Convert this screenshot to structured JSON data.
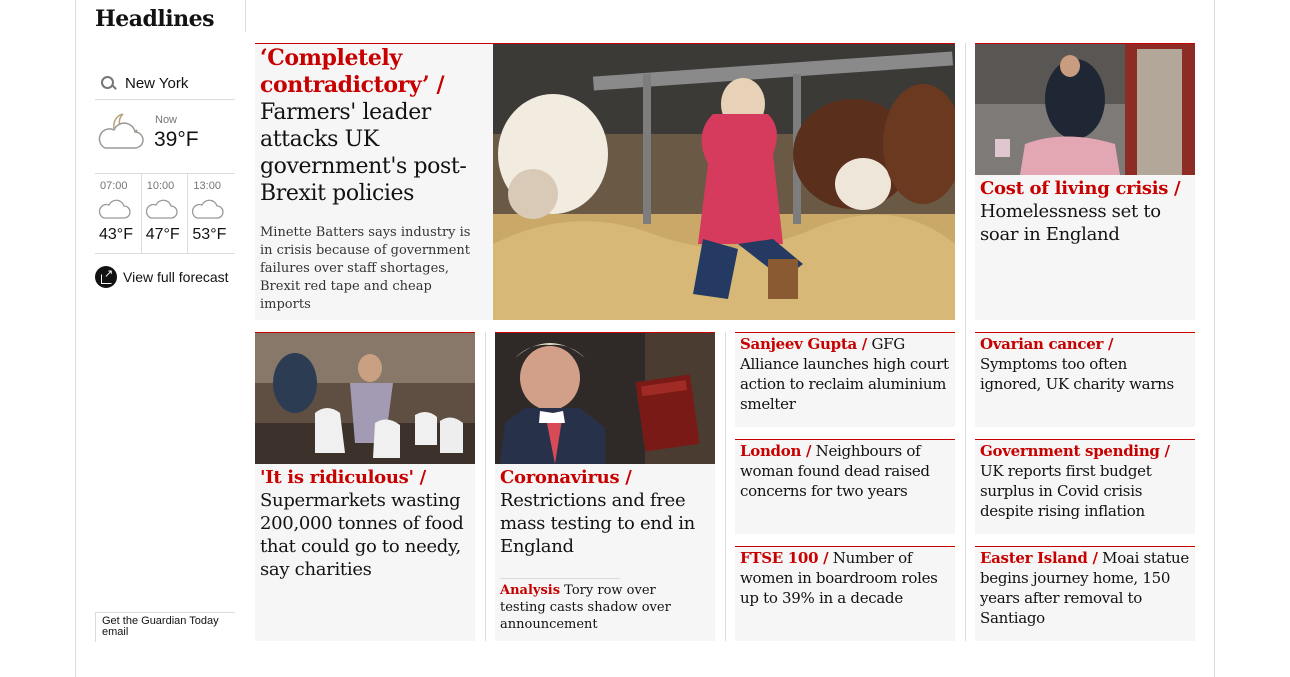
{
  "section": {
    "title": "Headlines"
  },
  "weather": {
    "location": "New York",
    "now_label": "Now",
    "now_temp": "39°F",
    "now_icon": "cloud-moon-icon",
    "forecast": [
      {
        "time": "07:00",
        "temp": "43°F",
        "icon": "cloud-icon"
      },
      {
        "time": "10:00",
        "temp": "47°F",
        "icon": "cloud-icon"
      },
      {
        "time": "13:00",
        "temp": "53°F",
        "icon": "cloud-icon"
      }
    ],
    "view_forecast": "View full forecast"
  },
  "signup": {
    "text": "Get the Guardian Today email"
  },
  "colors": {
    "kicker": "#c70000",
    "card_bg": "#f6f6f6",
    "rule": "#dcdcdc"
  },
  "stories": {
    "lead": {
      "kicker": "‘Completely contradictory’ /",
      "headline": "Farmers' leader attacks UK government's post-Brexit policies",
      "standfirst": "Minette Batters says industry is in crisis because of government failures over staff shortages, Brexit red tape and cheap imports"
    },
    "homeless": {
      "kicker": "Cost of living crisis /",
      "headline": "Homelessness set to soar in England"
    },
    "food": {
      "kicker": "'It is ridiculous' /",
      "headline": "Supermarkets wasting 200,000 tonnes of food that could go to needy, say charities"
    },
    "covid": {
      "kicker": "Coronavirus /",
      "headline": "Restrictions and free mass testing to end in England",
      "sublink_kicker": "Analysis",
      "sublink": "Tory row over testing casts shadow over announcement"
    },
    "gupta": {
      "kicker": "Sanjeev Gupta /",
      "headline": "GFG Alliance launches high court action to reclaim aluminium smelter"
    },
    "london": {
      "kicker": "London /",
      "headline": "Neighbours of woman found dead raised concerns for two years"
    },
    "ftse": {
      "kicker": "FTSE 100  /",
      "headline": "Number of women in boardroom roles up to 39% in a decade"
    },
    "ovarian": {
      "kicker": "Ovarian cancer /",
      "headline": "Symptoms too often ignored, UK charity warns"
    },
    "spending": {
      "kicker": "Government spending /",
      "headline": "UK reports first budget surplus in Covid crisis despite rising inflation"
    },
    "easter": {
      "kicker": "Easter Island /",
      "headline": "Moai statue begins journey home, 150 years after removal to Santiago"
    }
  }
}
